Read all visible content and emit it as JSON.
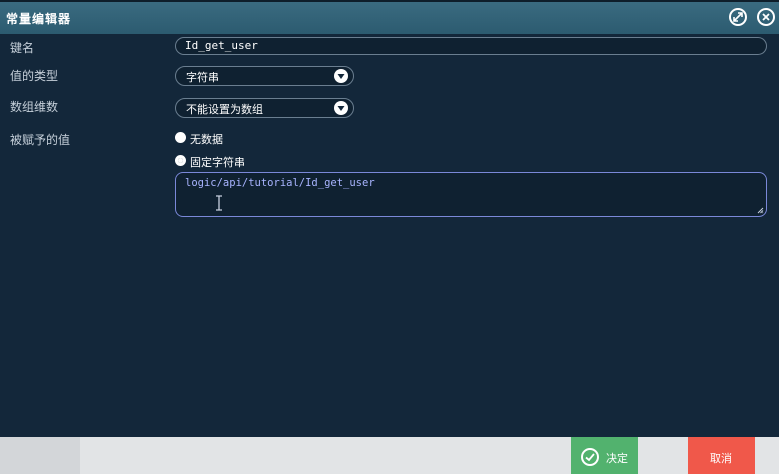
{
  "window": {
    "title": "常量编辑器"
  },
  "form": {
    "key_name": {
      "label": "键名",
      "value": "Id_get_user"
    },
    "value_type": {
      "label": "值的类型",
      "selected": "字符串"
    },
    "array_dimension": {
      "label": "数组维数",
      "selected": "不能设置为数组"
    },
    "assigned_value": {
      "label": "被赋予的值",
      "options": [
        {
          "label": "无数据",
          "checked": false
        },
        {
          "label": "固定字符串",
          "checked": true
        }
      ],
      "text": "logic/api/tutorial/Id_get_user"
    }
  },
  "footer": {
    "ok_label": "决定",
    "cancel_label": "取消"
  },
  "colors": {
    "background": "#13273a",
    "titlebar": "#2c5b70",
    "ok": "#52b26e",
    "cancel": "#f0584a",
    "value_text": "#a8b4ff"
  },
  "icons": {
    "settings": "gear-arrows-icon",
    "close": "close-icon",
    "dropdown": "chevron-down-icon",
    "ok": "checkmark-icon",
    "cursor": "text-cursor-icon",
    "resize": "resize-grip-icon"
  }
}
